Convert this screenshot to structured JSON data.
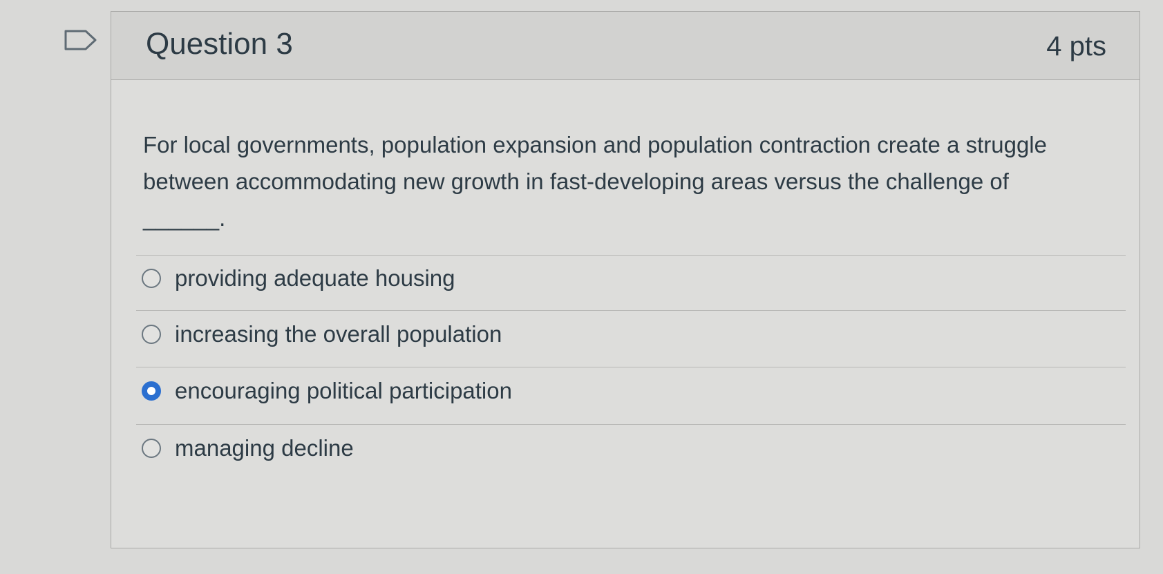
{
  "question": {
    "title": "Question 3",
    "points": "4 pts",
    "text": "For local governments, population expansion and population contraction create a struggle between accommodating new growth in fast-developing areas versus the challenge of ______."
  },
  "answers": [
    {
      "label": "providing adequate housing",
      "selected": false
    },
    {
      "label": "increasing the overall population",
      "selected": false
    },
    {
      "label": "encouraging political participation",
      "selected": true
    },
    {
      "label": "managing decline",
      "selected": false
    }
  ],
  "colors": {
    "accent": "#2b6fd0",
    "text": "#2d3b45",
    "background": "#d9d9d7"
  },
  "icons": {
    "flag": "flag-icon",
    "radio": "radio-icon"
  }
}
